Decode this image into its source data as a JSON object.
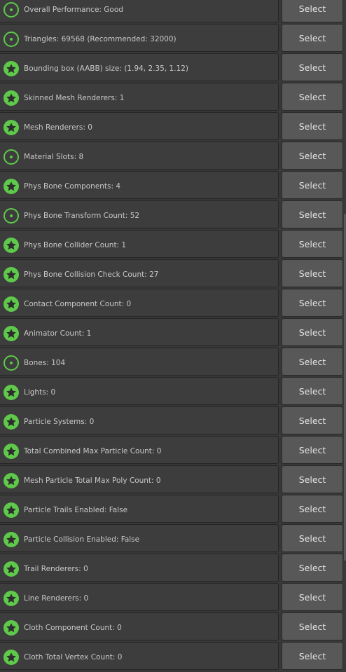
{
  "select_label": "Select",
  "colors": {
    "good": "#5ec94a",
    "row_background": "#3d3d3d",
    "button_background": "#585858"
  },
  "rows": [
    {
      "label": "Overall Performance: Good",
      "rating_icon": "good-circle-icon"
    },
    {
      "label": "Triangles: 69568 (Recommended: 32000)",
      "rating_icon": "good-circle-icon"
    },
    {
      "label": "Bounding box (AABB) size: (1.94, 2.35, 1.12)",
      "rating_icon": "excellent-star-icon"
    },
    {
      "label": "Skinned Mesh Renderers: 1",
      "rating_icon": "excellent-star-icon"
    },
    {
      "label": "Mesh Renderers: 0",
      "rating_icon": "excellent-star-icon"
    },
    {
      "label": "Material Slots: 8",
      "rating_icon": "good-circle-icon"
    },
    {
      "label": "Phys Bone Components: 4",
      "rating_icon": "excellent-star-icon"
    },
    {
      "label": "Phys Bone Transform Count: 52",
      "rating_icon": "good-circle-icon"
    },
    {
      "label": "Phys Bone Collider Count: 1",
      "rating_icon": "excellent-star-icon"
    },
    {
      "label": "Phys Bone Collision Check Count: 27",
      "rating_icon": "excellent-star-icon"
    },
    {
      "label": "Contact Component Count: 0",
      "rating_icon": "excellent-star-icon"
    },
    {
      "label": "Animator Count: 1",
      "rating_icon": "excellent-star-icon"
    },
    {
      "label": "Bones: 104",
      "rating_icon": "good-circle-icon"
    },
    {
      "label": "Lights: 0",
      "rating_icon": "excellent-star-icon"
    },
    {
      "label": "Particle Systems: 0",
      "rating_icon": "excellent-star-icon"
    },
    {
      "label": "Total Combined Max Particle Count: 0",
      "rating_icon": "excellent-star-icon"
    },
    {
      "label": "Mesh Particle Total Max Poly Count: 0",
      "rating_icon": "excellent-star-icon"
    },
    {
      "label": "Particle Trails Enabled: False",
      "rating_icon": "excellent-star-icon"
    },
    {
      "label": "Particle Collision Enabled: False",
      "rating_icon": "excellent-star-icon"
    },
    {
      "label": "Trail Renderers: 0",
      "rating_icon": "excellent-star-icon"
    },
    {
      "label": "Line Renderers: 0",
      "rating_icon": "excellent-star-icon"
    },
    {
      "label": "Cloth Component Count: 0",
      "rating_icon": "excellent-star-icon"
    },
    {
      "label": "Cloth Total Vertex Count: 0",
      "rating_icon": "excellent-star-icon"
    }
  ]
}
